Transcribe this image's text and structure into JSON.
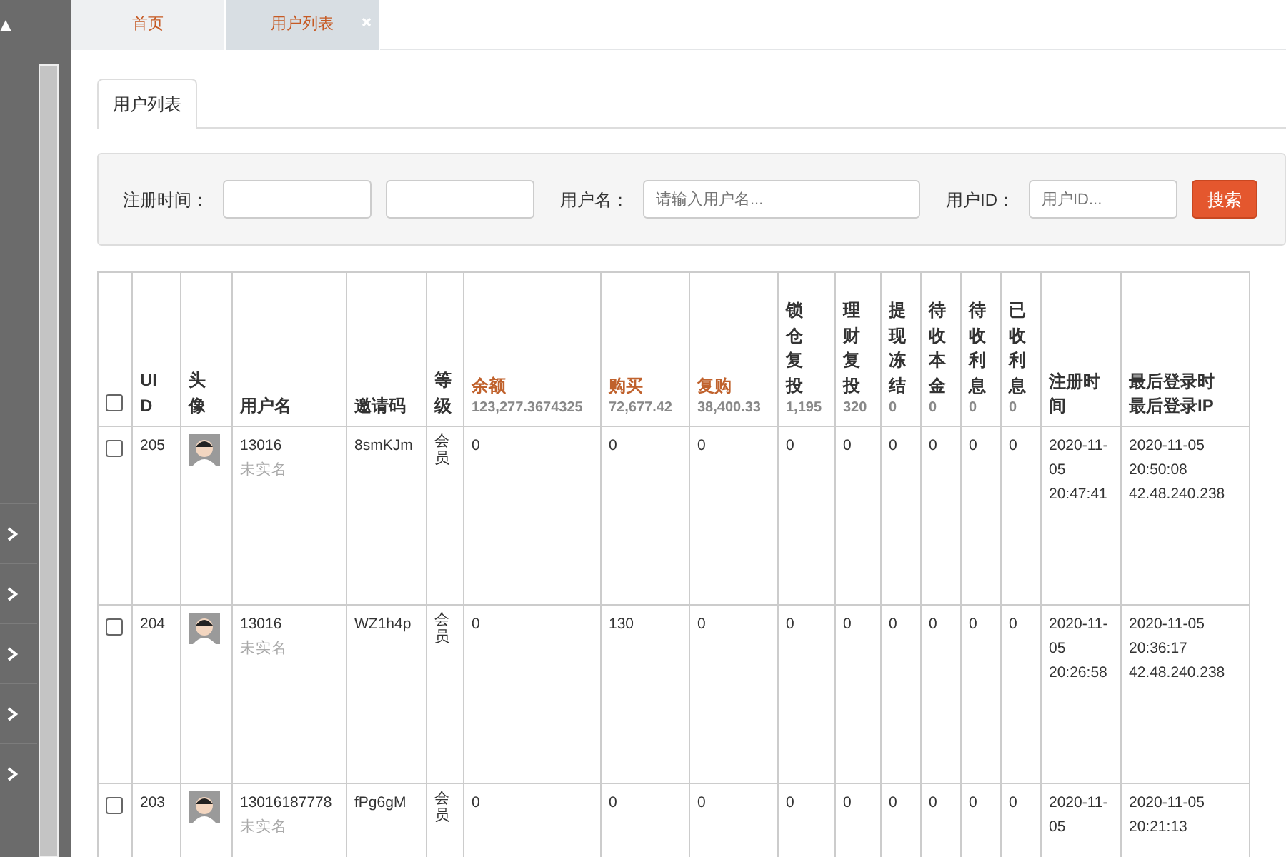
{
  "sidebar": {
    "items": [
      {
        "expanded": false
      },
      {
        "expanded": false
      },
      {
        "expanded": false
      },
      {
        "expanded": false
      },
      {
        "expanded": false
      }
    ]
  },
  "tabs": [
    {
      "label": "首页",
      "selected": false,
      "closable": false
    },
    {
      "label": "用户列表",
      "selected": true,
      "closable": true
    }
  ],
  "panel_tab": {
    "label": "用户列表"
  },
  "filters": [
    {
      "kind": "range",
      "label": "注册时间："
    },
    {
      "kind": "text",
      "label": "用户名：",
      "placeholder": "请输入用户名..."
    },
    {
      "kind": "text",
      "label": "用户ID：",
      "placeholder": "用户ID..."
    }
  ],
  "search_button": "搜索",
  "table": {
    "select_all_checked": false,
    "columns": [
      {
        "title": "UID"
      },
      {
        "title": "头像"
      },
      {
        "title": "用户名"
      },
      {
        "title": "邀请码"
      },
      {
        "title": "等级"
      },
      {
        "title": "余额",
        "total": "123,277.3674325",
        "highlight": true
      },
      {
        "title": "购买",
        "total": "72,677.42",
        "highlight": true
      },
      {
        "title": "复购",
        "total": "38,400.33",
        "highlight": true
      },
      {
        "title": "锁仓复投",
        "total": "1,195",
        "highlight": false
      },
      {
        "title": "理财复投",
        "total": "320",
        "highlight": false
      },
      {
        "title": "提现冻结",
        "total": "0",
        "highlight": false
      },
      {
        "title": "待收本金",
        "total": "0",
        "highlight": false
      },
      {
        "title": "待收利息",
        "total": "0",
        "highlight": false
      },
      {
        "title": "已收利息",
        "total": "0",
        "highlight": false
      },
      {
        "title": "注册时间"
      },
      {
        "title": "最后登录时",
        "subtitle": "最后登录IP"
      }
    ],
    "rows": [
      {
        "checked": false,
        "uid": "205",
        "username": "13016",
        "realname": "未实名",
        "invite_code": "8smKJm",
        "level": "会员",
        "values": [
          "0",
          "0",
          "0",
          "0",
          "0",
          "0",
          "0",
          "0",
          "0"
        ],
        "reg_time": "2020-11-05 20:47:41",
        "last_login": "2020-11-05 20:50:08",
        "last_ip": "42.48.240.238"
      },
      {
        "checked": false,
        "uid": "204",
        "username": "13016",
        "realname": "未实名",
        "invite_code": "WZ1h4p",
        "level": "会员",
        "values": [
          "0",
          "130",
          "0",
          "0",
          "0",
          "0",
          "0",
          "0",
          "0"
        ],
        "reg_time": "2020-11-05 20:26:58",
        "last_login": "2020-11-05 20:36:17",
        "last_ip": "42.48.240.238"
      },
      {
        "checked": false,
        "uid": "203",
        "username": "13016187778",
        "realname": "未实名",
        "invite_code": "fPg6gM",
        "level": "会员",
        "values": [
          "0",
          "0",
          "0",
          "0",
          "0",
          "0",
          "0",
          "0",
          "0"
        ],
        "reg_time": "2020-11-05",
        "last_login": "2020-11-05 20:21:13"
      }
    ]
  }
}
